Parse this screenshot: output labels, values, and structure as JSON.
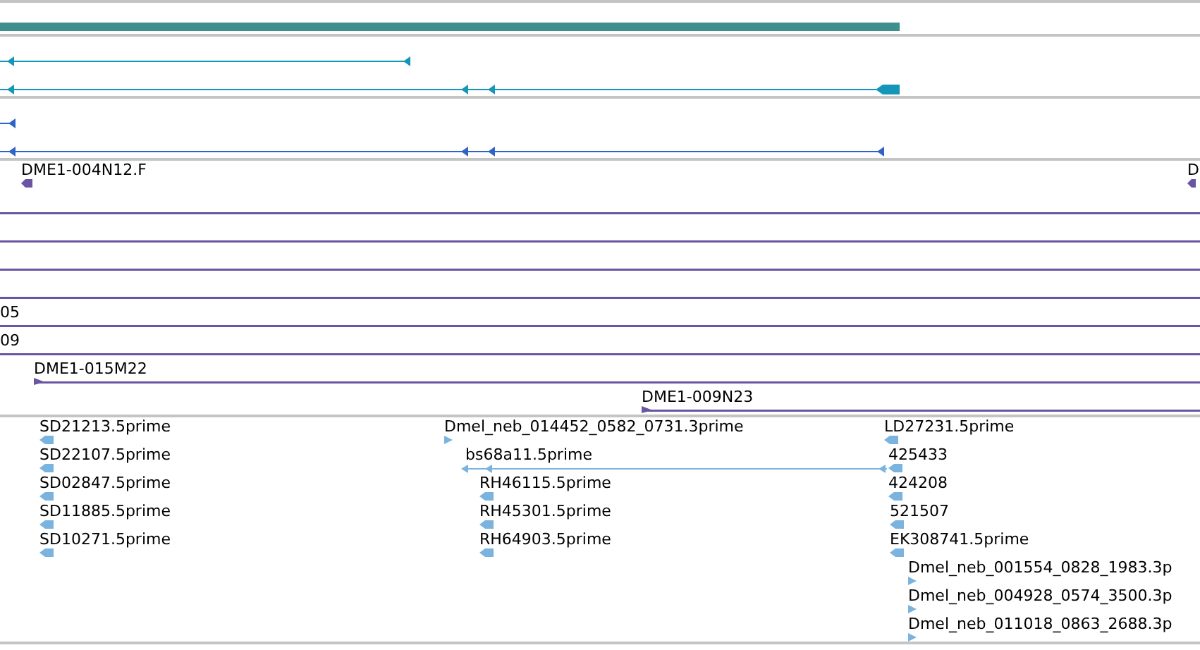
{
  "tracks": [
    {
      "kind": "coverage"
    },
    {
      "kind": "transcript",
      "features": [
        {
          "reverse": true
        },
        {
          "reverse": true
        }
      ]
    },
    {
      "kind": "transcript",
      "features": [
        {
          "reverse": true
        },
        {
          "reverse": true
        }
      ]
    },
    {
      "kind": "clone",
      "features": [
        {
          "kind": "glyph",
          "label": "DME1-004N12.F",
          "reverse": true
        },
        {
          "kind": "glyph",
          "label": "D",
          "reverse": true
        },
        {
          "kind": "span"
        },
        {
          "kind": "span"
        },
        {
          "kind": "span"
        },
        {
          "kind": "span"
        },
        {
          "kind": "span",
          "label": "05"
        },
        {
          "kind": "span",
          "label": "09"
        },
        {
          "kind": "span",
          "label": "DME1-015M22",
          "reverse": false
        },
        {
          "kind": "span",
          "label": "DME1-009N23",
          "reverse": false
        }
      ]
    },
    {
      "kind": "est",
      "features": [
        {
          "label": "SD21213.5prime",
          "reverse": true
        },
        {
          "label": "SD22107.5prime",
          "reverse": true
        },
        {
          "label": "SD02847.5prime",
          "reverse": true
        },
        {
          "label": "SD11885.5prime",
          "reverse": true
        },
        {
          "label": "SD10271.5prime",
          "reverse": true
        },
        {
          "label": "Dmel_neb_014452_0582_0731.3prime",
          "reverse": false
        },
        {
          "label": "bs68a11.5prime",
          "reverse": true
        },
        {
          "label": "RH46115.5prime",
          "reverse": true
        },
        {
          "label": "RH45301.5prime",
          "reverse": true
        },
        {
          "label": "RH64903.5prime",
          "reverse": true
        },
        {
          "label": "LD27231.5prime",
          "reverse": true
        },
        {
          "label": "425433",
          "reverse": true
        },
        {
          "label": "424208",
          "reverse": true
        },
        {
          "label": "521507",
          "reverse": true
        },
        {
          "label": "EK308741.5prime",
          "reverse": true
        },
        {
          "label": "Dmel_neb_001554_0828_1983.3p",
          "reverse": false
        },
        {
          "label": "Dmel_neb_004928_0574_3500.3p",
          "reverse": false
        },
        {
          "label": "Dmel_neb_011018_0863_2688.3p",
          "reverse": false
        }
      ]
    }
  ]
}
